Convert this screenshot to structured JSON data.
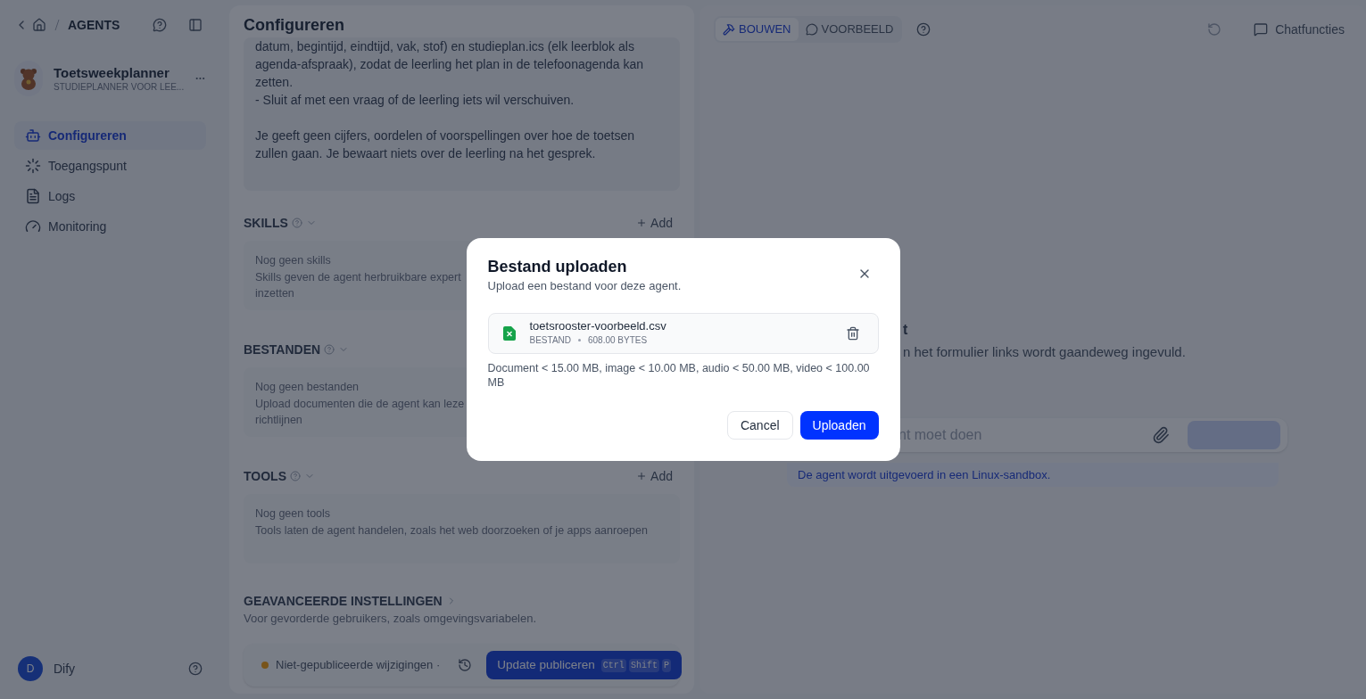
{
  "sidebar": {
    "breadcrumb": "AGENTS",
    "app": {
      "name": "Toetsweekplanner",
      "subtitle": "STUDIEPLANNER VOOR LEE..."
    },
    "nav": [
      {
        "label": "Configureren",
        "selected": true
      },
      {
        "label": "Toegangspunt",
        "selected": false
      },
      {
        "label": "Logs",
        "selected": false
      },
      {
        "label": "Monitoring",
        "selected": false
      }
    ],
    "user": {
      "initial": "D",
      "name": "Dify"
    }
  },
  "config": {
    "title": "Configureren",
    "prompt": [
      "datum, begintijd, eindtijd, vak, stof) en studieplan.ics (elk leerblok als agenda-afspraak), zodat de leerling het plan in de telefoonagenda kan zetten.\n- Sluit af met een vraag of de leerling iets wil verschuiven.",
      "Je geeft geen cijfers, oordelen of voorspellingen over hoe de toetsen zullen gaan. Je bewaart niets over de leerling na het gesprek."
    ],
    "sections": [
      {
        "title": "SKILLS",
        "add": "Add",
        "empty_title": "Nog geen skills",
        "empty_text": [
          "Skills geven de agent herbruikbare expert",
          "inzetten"
        ]
      },
      {
        "title": "BESTANDEN",
        "empty_title": "Nog geen bestanden",
        "empty_text": [
          "Upload documenten die de agent kan leze",
          "richtlijnen"
        ]
      },
      {
        "title": "TOOLS",
        "add": "Add",
        "empty_title": "Nog geen tools",
        "empty_text": [
          "Tools laten de agent handelen, zoals het web doorzoeken of je apps aanroepen"
        ]
      }
    ],
    "advanced": {
      "title": "GEAVANCEERDE INSTELLINGEN",
      "description": "Voor gevorderde gebruikers, zoals omgevingsvariabelen."
    },
    "footer": {
      "status": "Niet-gepubliceerde wijzigingen ·",
      "publish": "Update publiceren",
      "keys": [
        "Ctrl",
        "Shift",
        "P"
      ]
    }
  },
  "preview": {
    "tabs": [
      {
        "label": "BOUWEN",
        "selected": true
      },
      {
        "label": "VOORBEELD",
        "selected": false
      }
    ],
    "chat_features": "Chatfuncties",
    "heading": "t",
    "description": "n het formulier links wordt gaandeweg ingevuld.",
    "input_placeholder": "nt moet doen",
    "sandbox_note": "De agent wordt uitgevoerd in een Linux-sandbox."
  },
  "dialog": {
    "title": "Bestand uploaden",
    "subtitle": "Upload een bestand voor deze agent.",
    "file": {
      "name": "toetsrooster-voorbeeld.csv",
      "type": "BESTAND",
      "size": "608.00 BYTES"
    },
    "limits": "Document < 15.00 MB, image < 10.00 MB, audio < 50.00 MB, video < 100.00 MB",
    "cancel": "Cancel",
    "confirm": "Uploaden"
  }
}
